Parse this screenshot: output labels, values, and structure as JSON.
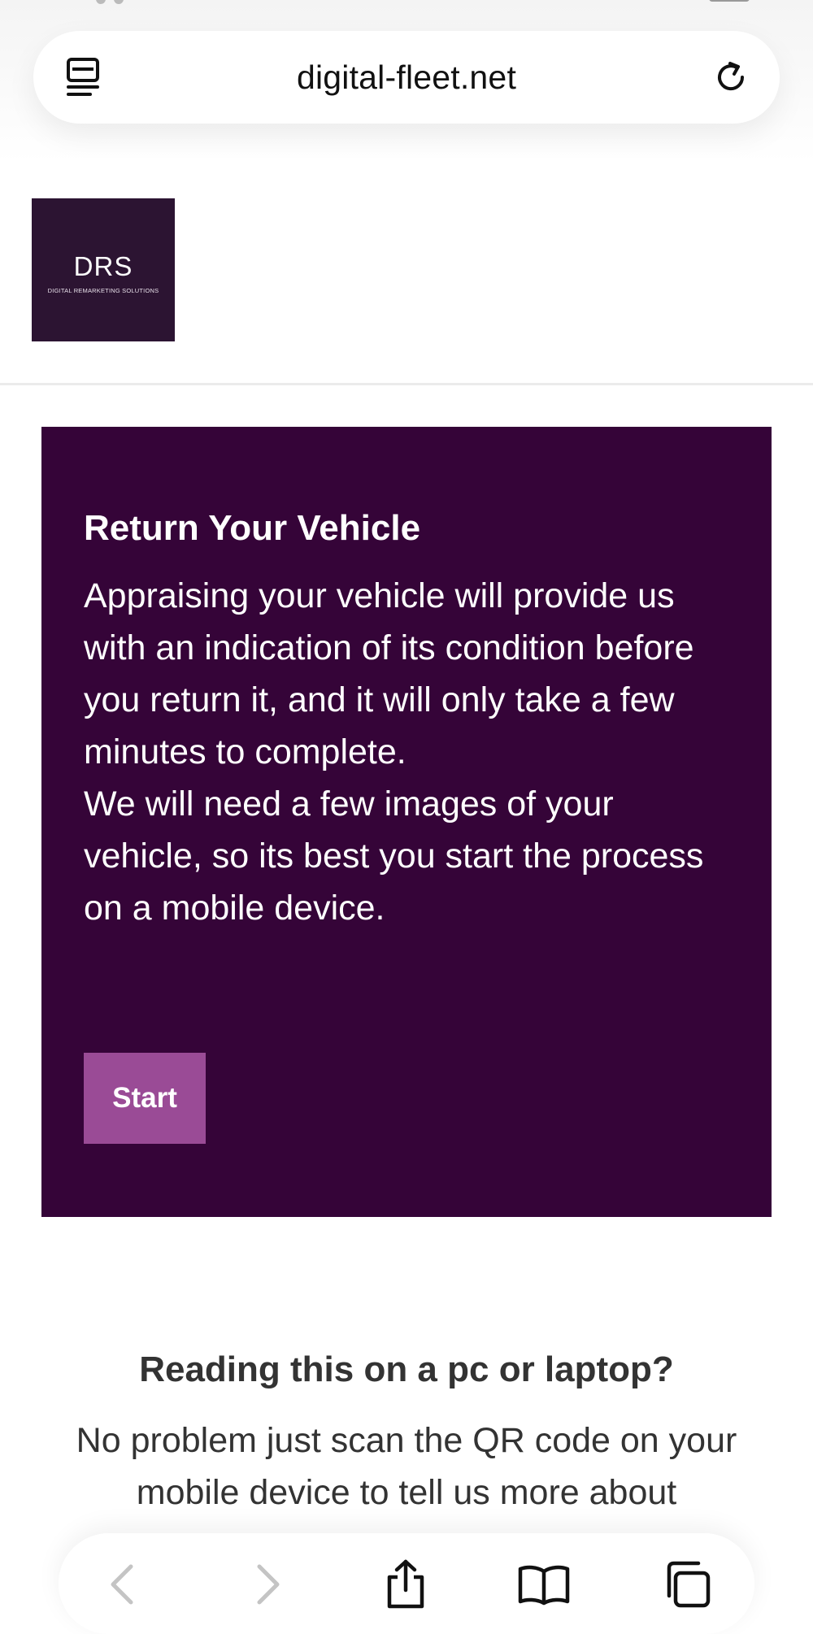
{
  "browser": {
    "url": "digital-fleet.net"
  },
  "logo": {
    "title": "DRS",
    "subtitle": "DIGITAL REMARKETING SOLUTIONS",
    "bg_color": "#2c1432"
  },
  "hero": {
    "bg_color": "#350438",
    "heading": "Return Your Vehicle",
    "paragraph_1": "Appraising your vehicle will provide us with an indication of its condition before you return it, and it will only take a few minutes to complete.",
    "paragraph_2": "We will need a few images of your vehicle, so its best you start the process on a mobile device.",
    "start_label": "Start",
    "button_color": "#9a4b96"
  },
  "pc_section": {
    "heading": "Reading this on a pc or laptop?",
    "text": "No problem just scan the QR code on your mobile device to tell us more about"
  },
  "toolbar": {
    "icons": [
      "back-icon",
      "forward-icon",
      "share-icon",
      "bookmarks-icon",
      "tabs-icon"
    ]
  }
}
